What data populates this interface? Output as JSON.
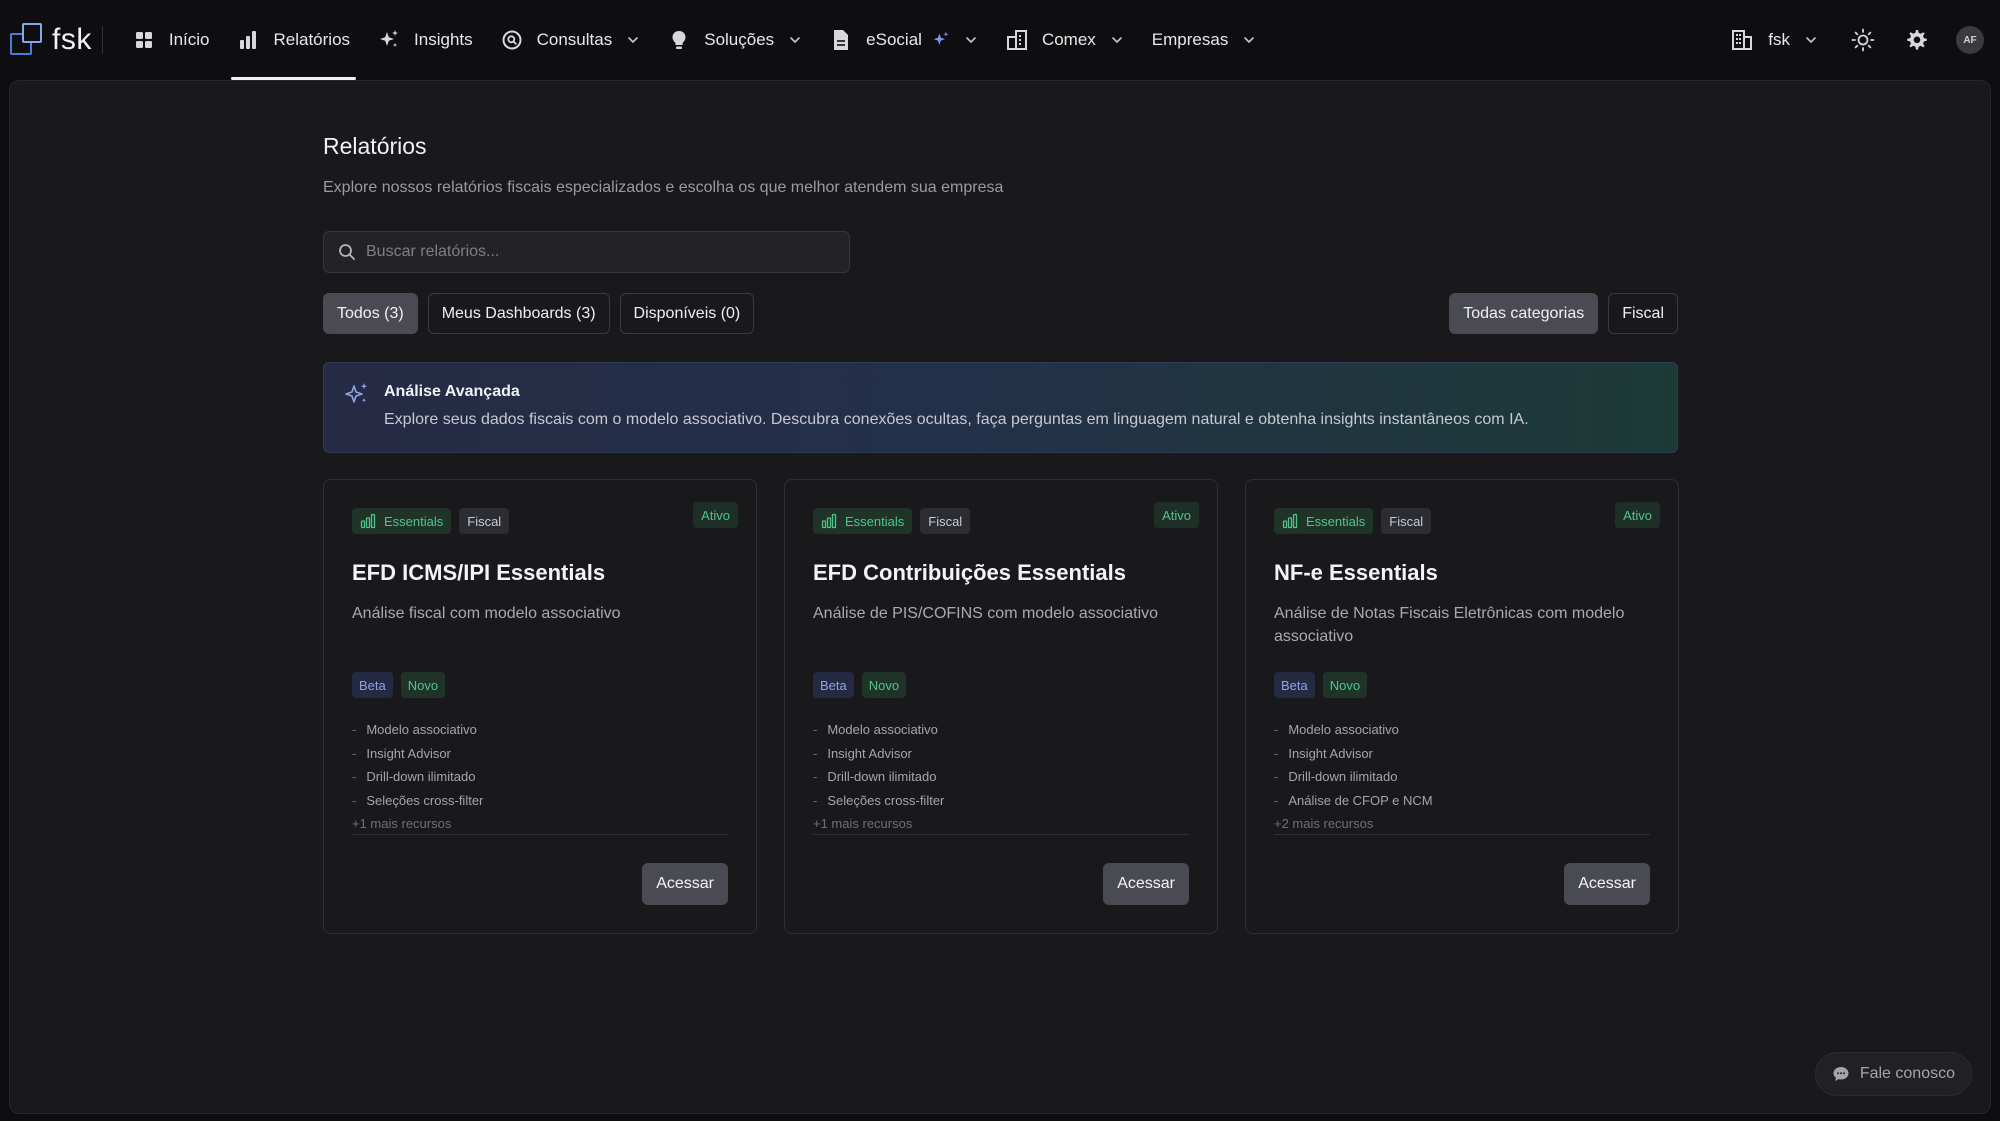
{
  "brand": {
    "name": "fsk"
  },
  "nav": {
    "items": [
      {
        "label": "Início",
        "icon": "grid-icon",
        "dropdown": false
      },
      {
        "label": "Relatórios",
        "icon": "bar-chart-icon",
        "dropdown": false,
        "active": true
      },
      {
        "label": "Insights",
        "icon": "sparkles-icon",
        "dropdown": false
      },
      {
        "label": "Consultas",
        "icon": "search-circle-icon",
        "dropdown": true
      },
      {
        "label": "Soluções",
        "icon": "lightbulb-icon",
        "dropdown": true
      },
      {
        "label": "eSocial",
        "icon": "document-icon",
        "dropdown": true
      },
      {
        "label": "Comex",
        "icon": "building-icon",
        "dropdown": true
      },
      {
        "label": "Empresas",
        "icon": "",
        "dropdown": true
      }
    ],
    "org": "fsk",
    "avatar": "AF"
  },
  "page": {
    "title": "Relatórios",
    "subtitle": "Explore nossos relatórios fiscais especializados e escolha os que melhor atendem sua empresa",
    "search_placeholder": "Buscar relatórios..."
  },
  "filters": {
    "tabs": [
      "Todos (3)",
      "Meus Dashboards (3)",
      "Disponíveis (0)"
    ],
    "active_tab": 0,
    "categories": [
      "Todas categorias",
      "Fiscal"
    ],
    "active_category": 0
  },
  "banner": {
    "title": "Análise Avançada",
    "text": "Explore seus dados fiscais com o modelo associativo. Descubra conexões ocultas, faça perguntas em linguagem natural e obtenha insights instantâneos com IA."
  },
  "cards": [
    {
      "badge_essentials": "Essentials",
      "badge_category": "Fiscal",
      "status": "Ativo",
      "title": "EFD ICMS/IPI Essentials",
      "description": "Análise fiscal com modelo associativo",
      "tags": [
        "Beta",
        "Novo"
      ],
      "features": [
        "Modelo associativo",
        "Insight Advisor",
        "Drill-down ilimitado",
        "Seleções cross-filter"
      ],
      "more": "+1 mais recursos",
      "action": "Acessar"
    },
    {
      "badge_essentials": "Essentials",
      "badge_category": "Fiscal",
      "status": "Ativo",
      "title": "EFD Contribuições Essentials",
      "description": "Análise de PIS/COFINS com modelo associativo",
      "tags": [
        "Beta",
        "Novo"
      ],
      "features": [
        "Modelo associativo",
        "Insight Advisor",
        "Drill-down ilimitado",
        "Seleções cross-filter"
      ],
      "more": "+1 mais recursos",
      "action": "Acessar"
    },
    {
      "badge_essentials": "Essentials",
      "badge_category": "Fiscal",
      "status": "Ativo",
      "title": "NF-e Essentials",
      "description": "Análise de Notas Fiscais Eletrônicas com modelo associativo",
      "tags": [
        "Beta",
        "Novo"
      ],
      "features": [
        "Modelo associativo",
        "Insight Advisor",
        "Drill-down ilimitado",
        "Análise de CFOP e NCM"
      ],
      "more": "+2 mais recursos",
      "action": "Acessar"
    }
  ],
  "contact": {
    "label": "Fale conosco"
  },
  "colors": {
    "accent_green": "#4fc58a",
    "accent_blue": "#8fa2e6",
    "background": "#0e0e10",
    "panel": "#19191c"
  }
}
